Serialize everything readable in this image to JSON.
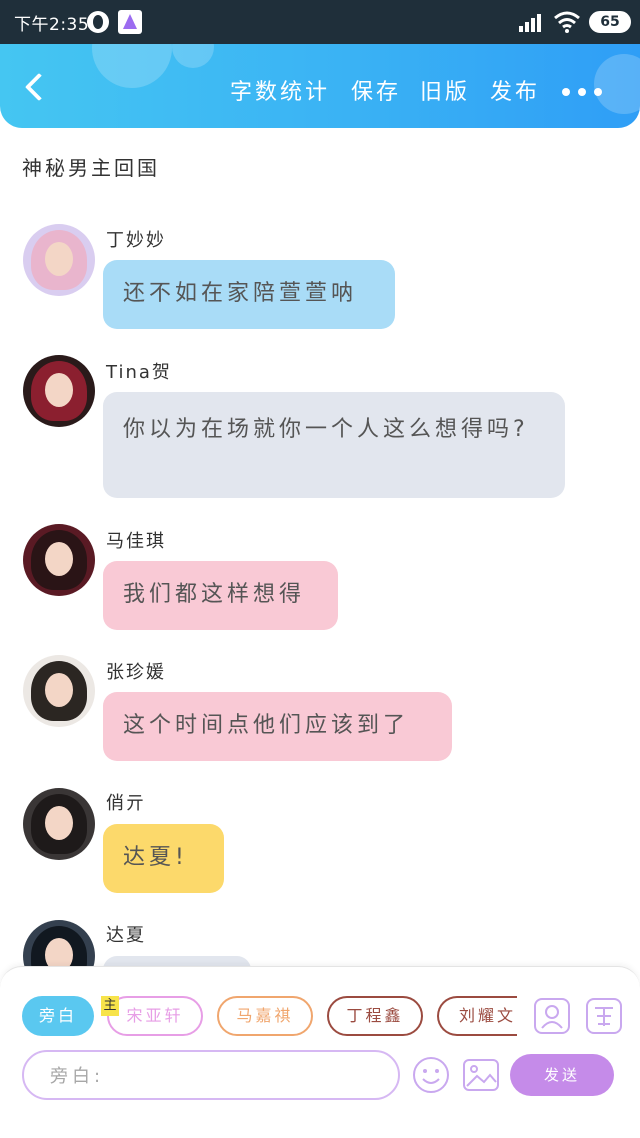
{
  "status_bar": {
    "time": "下午2:35",
    "battery": "65"
  },
  "header": {
    "actions": [
      "字数统计",
      "保存",
      "旧版",
      "发布"
    ]
  },
  "story": {
    "title": "神秘男主回国"
  },
  "messages": [
    {
      "sender": "丁妙妙",
      "text": "还不如在家陪萱萱呐",
      "color": "#a9dcf7"
    },
    {
      "sender": "Tina贺",
      "text": "你以为在场就你一个人这么想得吗?",
      "color": "#e2e6ee"
    },
    {
      "sender": "马佳琪",
      "text": "我们都这样想得",
      "color": "#f9c9d5"
    },
    {
      "sender": "张珍媛",
      "text": "这个时间点他们应该到了",
      "color": "#f9c9d5"
    },
    {
      "sender": "俏亓",
      "text": "达夏!",
      "color": "#fcd96b"
    },
    {
      "sender": "达夏",
      "text": "",
      "color": "#e2e6ee"
    }
  ],
  "roles": {
    "narration": "旁白",
    "main_tag": "主",
    "chips": [
      "宋亚轩",
      "马嘉祺",
      "丁程鑫",
      "刘耀文"
    ],
    "chip_colors": [
      "#e79ee6",
      "#f0a66e",
      "#9b4b40",
      "#9b4b40"
    ]
  },
  "input": {
    "placeholder": "旁白:"
  },
  "send_label": "发送",
  "icons": [
    "avatar-icon",
    "tag-icon",
    "emoji-icon",
    "image-icon"
  ],
  "accent": "#3ab2f4"
}
